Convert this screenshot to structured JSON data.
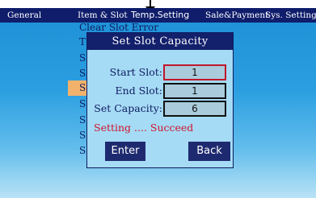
{
  "tabs": [
    {
      "label": "General"
    },
    {
      "label": "Item & Slot"
    },
    {
      "label": "Temp.Setting"
    },
    {
      "label": "Sale&Payment"
    },
    {
      "label": "Sys. Setting"
    }
  ],
  "submenu": {
    "items": [
      {
        "label": "Clear Slot Error"
      },
      {
        "label": "T"
      },
      {
        "label": "S"
      },
      {
        "label": "S"
      },
      {
        "label": "S"
      },
      {
        "label": "S"
      },
      {
        "label": "S"
      },
      {
        "label": "S"
      },
      {
        "label": "S"
      }
    ],
    "highlighted_index": 4
  },
  "dialog": {
    "title": "Set Slot Capacity",
    "start_slot": {
      "label": "Start Slot:",
      "value": "1"
    },
    "end_slot": {
      "label": "End Slot:",
      "value": "1"
    },
    "capacity": {
      "label": "Set Capacity:",
      "value": "6"
    },
    "status": "Setting .... Succeed",
    "enter_label": "Enter",
    "back_label": "Back"
  },
  "colors": {
    "tab_bar": "#0f1d6b",
    "dialog_bg": "#a6dbf5",
    "title_bar": "#13206c",
    "status_text": "#d0132a",
    "active_field_border": "#c0152a",
    "menu_highlight": "#f2b26b"
  },
  "icons": {
    "pointer": "down-arrow-icon"
  }
}
